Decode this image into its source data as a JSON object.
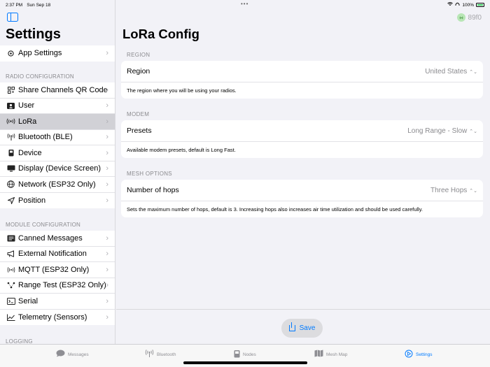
{
  "status": {
    "time": "2:37 PM",
    "date": "Sun Sep 18",
    "battery": "100%"
  },
  "sidebar": {
    "title": "Settings",
    "top_items": [
      {
        "label": "App Settings",
        "icon": "gear-icon"
      }
    ],
    "radio_section": "RADIO CONFIGURATION",
    "radio_items": [
      {
        "label": "Share Channels QR Code",
        "icon": "qrcode-icon"
      },
      {
        "label": "User",
        "icon": "person-card-icon"
      },
      {
        "label": "LoRa",
        "icon": "radio-waves-icon"
      },
      {
        "label": "Bluetooth (BLE)",
        "icon": "antenna-icon"
      },
      {
        "label": "Device",
        "icon": "device-icon"
      },
      {
        "label": "Display (Device Screen)",
        "icon": "display-icon"
      },
      {
        "label": "Network (ESP32 Only)",
        "icon": "globe-icon"
      },
      {
        "label": "Position",
        "icon": "location-icon"
      }
    ],
    "module_section": "MODULE CONFIGURATION",
    "module_items": [
      {
        "label": "Canned Messages",
        "icon": "message-list-icon"
      },
      {
        "label": "External Notification",
        "icon": "megaphone-icon"
      },
      {
        "label": "MQTT (ESP32 Only)",
        "icon": "broadcast-icon"
      },
      {
        "label": "Range Test (ESP32 Only)",
        "icon": "nodes-icon"
      },
      {
        "label": "Serial",
        "icon": "terminal-icon"
      },
      {
        "label": "Telemetry (Sensors)",
        "icon": "chart-icon"
      }
    ],
    "logging_section": "LOGGING",
    "selected": "LoRa"
  },
  "main": {
    "node_name": "89f0",
    "title": "LoRa Config",
    "sections": [
      {
        "label": "REGION",
        "row_label": "Region",
        "value": "United States",
        "desc": "The region where you will be using your radios."
      },
      {
        "label": "MODEM",
        "row_label": "Presets",
        "value": "Long Range - Slow",
        "desc": "Available modem presets, default is Long Fast."
      },
      {
        "label": "MESH OPTIONS",
        "row_label": "Number of hops",
        "value": "Three Hops",
        "desc": "Sets the maximum number of hops, default is 3. Increasing hops also increases air time utilization and should be used carefully."
      }
    ],
    "save_label": "Save"
  },
  "tabs": [
    {
      "label": "Messages",
      "icon": "chat-bubble-icon"
    },
    {
      "label": "Bluetooth",
      "icon": "antenna-icon"
    },
    {
      "label": "Nodes",
      "icon": "device-icon"
    },
    {
      "label": "Mesh Map",
      "icon": "map-icon"
    },
    {
      "label": "Settings",
      "icon": "gear-icon",
      "active": true
    }
  ],
  "colors": {
    "accent": "#007aff",
    "selected_row": "#d1d1d6",
    "node_badge": "#b8e6b5"
  }
}
